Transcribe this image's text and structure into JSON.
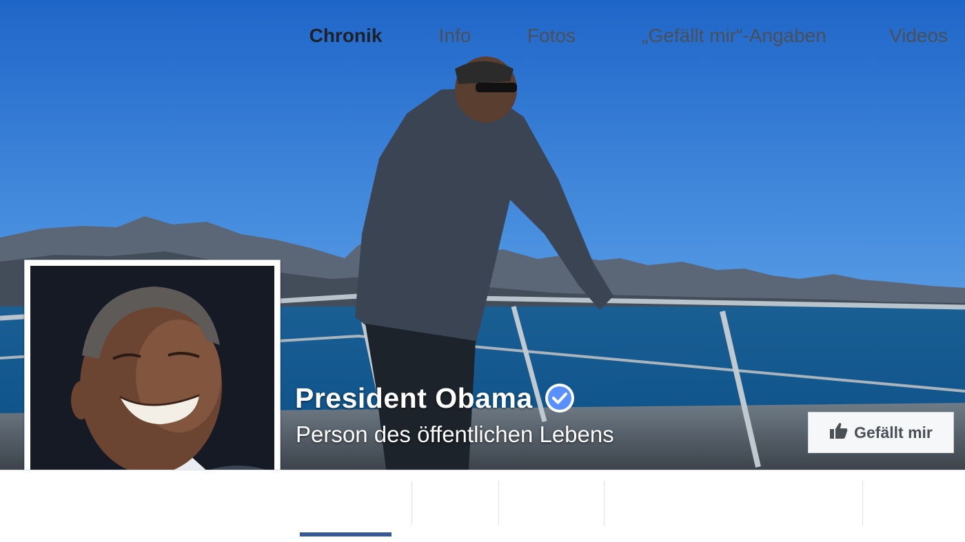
{
  "page": {
    "name": "President Obama",
    "category": "Person des öffentlichen Lebens",
    "verified": true,
    "verified_icon": "verified-badge-icon"
  },
  "like_button": {
    "label": "Gefällt mir",
    "icon": "thumbs-up-icon"
  },
  "tabs": [
    {
      "label": "Chronik",
      "active": true
    },
    {
      "label": "Info",
      "active": false
    },
    {
      "label": "Fotos",
      "active": false
    },
    {
      "label": "„Gefällt mir“-Angaben",
      "active": false
    },
    {
      "label": "Videos",
      "active": false
    }
  ],
  "colors": {
    "accent": "#365899",
    "verified": "#5890ff",
    "tab_text": "#4b4f56",
    "tab_active_text": "#1d2129",
    "sky": "#2a74d2",
    "sea": "#0f5b92"
  }
}
